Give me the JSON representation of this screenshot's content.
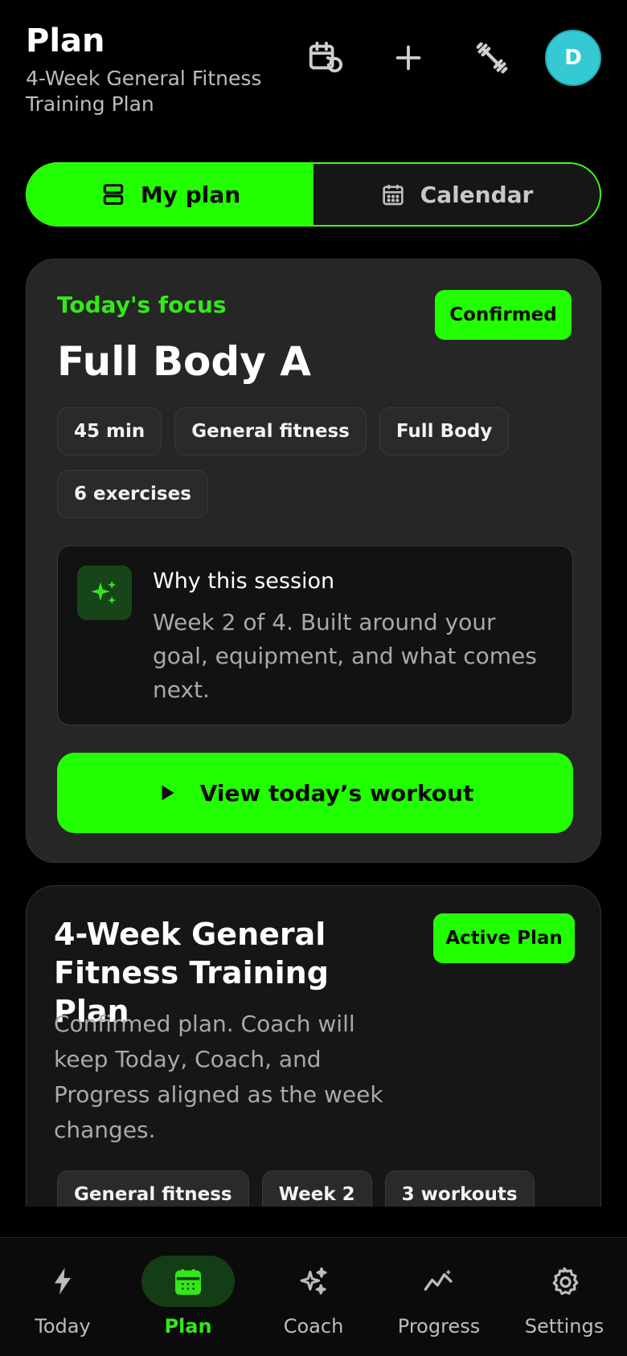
{
  "header": {
    "title": "Plan",
    "subtitle": "4-Week General Fitness Training Plan",
    "avatar_initial": "D",
    "icons": [
      "calendar-refresh-icon",
      "plus-icon",
      "dumbbell-icon"
    ]
  },
  "segmented": {
    "my_plan": "My plan",
    "calendar": "Calendar",
    "selected": "my_plan"
  },
  "focus": {
    "kicker": "Today's focus",
    "status": "Confirmed",
    "title": "Full Body A",
    "chips": [
      "45 min",
      "General fitness",
      "Full Body",
      "6 exercises"
    ],
    "why_title": "Why this session",
    "why_text": "Week 2 of 4. Built around your goal, equipment, and what comes next.",
    "cta": "View today’s workout"
  },
  "plan": {
    "title": "4-Week General Fitness Training Plan",
    "badge": "Active Plan",
    "description": "Confirmed plan. Coach will keep Today, Coach, and Progress aligned as the week changes.",
    "chips": [
      "General fitness",
      "Week 2",
      "3 workouts"
    ]
  },
  "nav": {
    "items": [
      {
        "label": "Today",
        "icon": "bolt-icon"
      },
      {
        "label": "Plan",
        "icon": "calendar-icon"
      },
      {
        "label": "Coach",
        "icon": "sparkles-icon"
      },
      {
        "label": "Progress",
        "icon": "trend-icon"
      },
      {
        "label": "Settings",
        "icon": "gear-icon"
      }
    ],
    "active": "Plan"
  },
  "colors": {
    "accent": "#22ff00",
    "accent_text": "#33e819",
    "avatar": "#35c9d4",
    "card": "#262626",
    "background": "#000000"
  }
}
